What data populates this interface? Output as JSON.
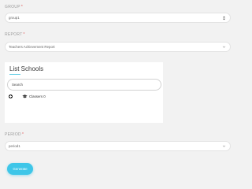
{
  "group": {
    "label": "GROUP",
    "required_mark": "*",
    "value": "group1"
  },
  "report": {
    "label": "REPORT",
    "required_mark": "*",
    "value": "Teachers Achievement Report"
  },
  "schools": {
    "title": "List Schools",
    "search_placeholder": "Search",
    "tree": [
      {
        "label": "Classers 0",
        "icon": "graduation-cap-icon",
        "expand_icon": "plus-circle-icon"
      }
    ]
  },
  "period": {
    "label": "PERIOD",
    "required_mark": "*",
    "value": "period1"
  },
  "actions": {
    "generate_label": "Generate"
  },
  "colors": {
    "accent": "#3ec6e8",
    "required": "#e05a5a",
    "background": "#f2f2f2"
  }
}
